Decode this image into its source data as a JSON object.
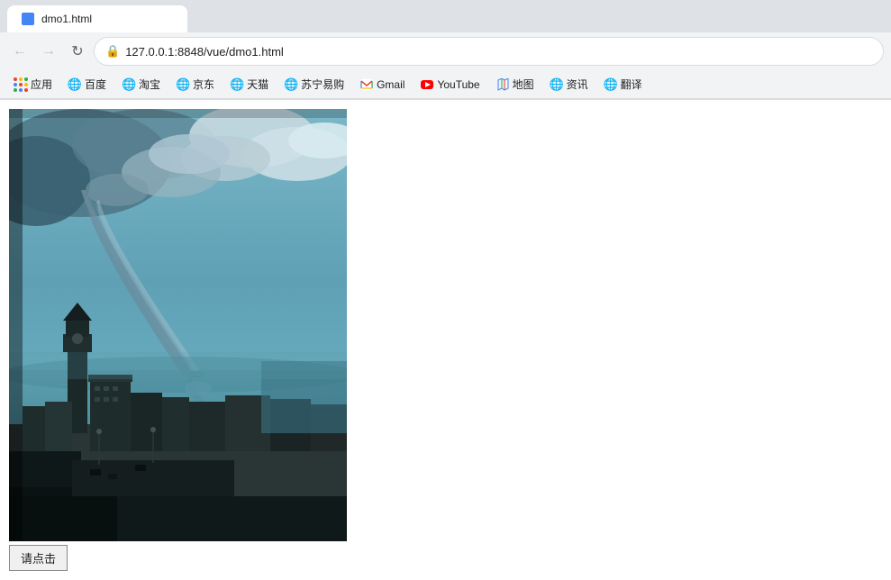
{
  "browser": {
    "tab": {
      "title": "dmo1.html",
      "favicon": "blue"
    },
    "address_bar": {
      "url": "127.0.0.1:8848/vue/dmo1.html",
      "lock_icon": "🔒"
    },
    "nav_buttons": {
      "back": "←",
      "forward": "→",
      "refresh": "↻"
    }
  },
  "bookmarks": [
    {
      "id": "apps",
      "label": "应用",
      "type": "apps"
    },
    {
      "id": "baidu",
      "label": "百度",
      "type": "globe",
      "color": "#2932e1"
    },
    {
      "id": "taobao",
      "label": "淘宝",
      "type": "globe",
      "color": "#ff5400"
    },
    {
      "id": "jd",
      "label": "京东",
      "type": "globe",
      "color": "#e4393c"
    },
    {
      "id": "tmall",
      "label": "天猫",
      "type": "globe",
      "color": "#e4393c"
    },
    {
      "id": "suning",
      "label": "苏宁易购",
      "type": "globe",
      "color": "#0070c8"
    },
    {
      "id": "gmail",
      "label": "Gmail",
      "type": "gmail",
      "color": "#ea4335"
    },
    {
      "id": "youtube",
      "label": "YouTube",
      "type": "youtube",
      "color": "#ff0000"
    },
    {
      "id": "ditu",
      "label": "地图",
      "type": "map",
      "color": "#4285f4"
    },
    {
      "id": "info",
      "label": "资讯",
      "type": "globe",
      "color": "#1a73e8"
    },
    {
      "id": "translate",
      "label": "翻译",
      "type": "globe",
      "color": "#1a73e8"
    }
  ],
  "page": {
    "image_alt": "Tornado over city painting",
    "button_label": "请点击"
  }
}
